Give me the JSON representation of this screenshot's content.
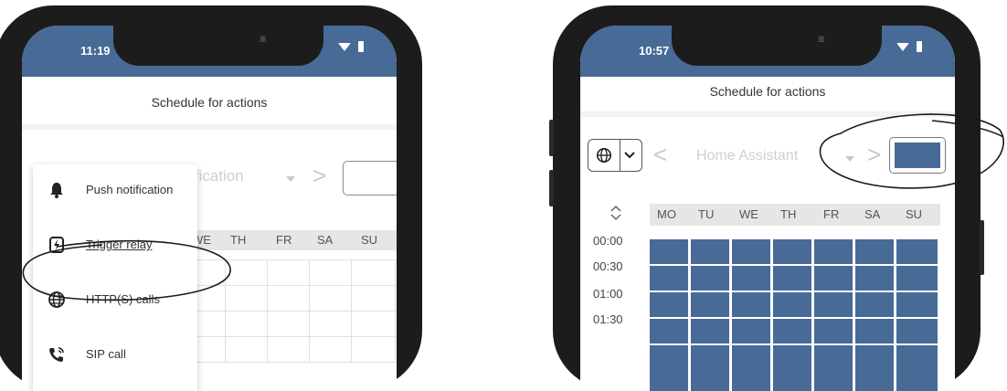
{
  "left_phone": {
    "status_time": "11:19",
    "title": "Schedule for actions",
    "selected_action_partial": "ification",
    "days": [
      "WE",
      "TH",
      "FR",
      "SA",
      "SU"
    ],
    "menu_items": [
      {
        "label": "Push notification",
        "icon": "bell-icon"
      },
      {
        "label": "Trigger relay",
        "icon": "relay-icon"
      },
      {
        "label": "HTTP(S) calls",
        "icon": "globe-icon"
      },
      {
        "label": "SIP call",
        "icon": "phone-call-icon"
      }
    ]
  },
  "right_phone": {
    "status_time": "10:57",
    "title": "Schedule for actions",
    "selected_action": "Home Assistant",
    "days": [
      "MO",
      "TU",
      "WE",
      "TH",
      "FR",
      "SA",
      "SU"
    ],
    "times": [
      "00:00",
      "00:30",
      "01:00",
      "01:30"
    ],
    "schedule_color": "#486a96"
  },
  "colors": {
    "status_bar": "#486a96",
    "phone_body": "#1c1c1c",
    "grid_fill": "#486a96",
    "annotation": "#1a1a1a"
  }
}
